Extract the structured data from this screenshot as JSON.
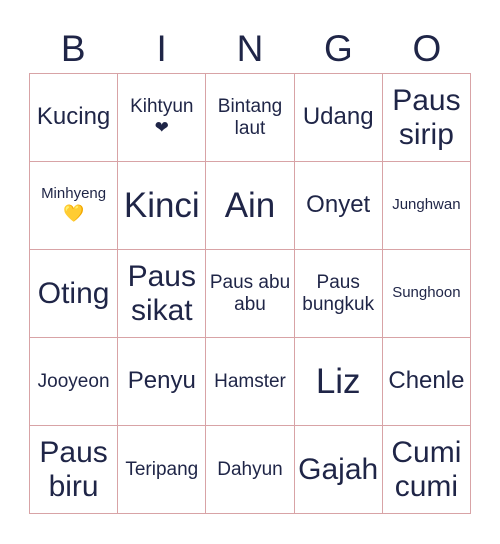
{
  "header": [
    "B",
    "I",
    "N",
    "G",
    "O"
  ],
  "colors": {
    "text": "#1f2547",
    "grid": "#d8a3a6",
    "yellow_heart": "#f6c21c"
  },
  "cells": [
    {
      "text": "Kucing",
      "size": "s-m"
    },
    {
      "text": "Kihtyun",
      "size": "s-s",
      "icon": "❤",
      "icon_name": "black-heart-icon",
      "icon_class": "heart-dark"
    },
    {
      "text": "Bintang laut",
      "size": "s-s"
    },
    {
      "text": "Udang",
      "size": "s-m"
    },
    {
      "text": "Paus sirip",
      "size": "s-l"
    },
    {
      "text": "Minhyeng",
      "size": "s-xs",
      "icon": "💛",
      "icon_name": "yellow-heart-icon",
      "icon_class": "heart-yellow"
    },
    {
      "text": "Kinci",
      "size": "s-xl"
    },
    {
      "text": "Ain",
      "size": "s-xl"
    },
    {
      "text": "Onyet",
      "size": "s-m"
    },
    {
      "text": "Junghwan",
      "size": "s-xs"
    },
    {
      "text": "Oting",
      "size": "s-l"
    },
    {
      "text": "Paus sikat",
      "size": "s-l"
    },
    {
      "text": "Paus abu abu",
      "size": "s-s"
    },
    {
      "text": "Paus bungkuk",
      "size": "s-s"
    },
    {
      "text": "Sunghoon",
      "size": "s-xs"
    },
    {
      "text": "Jooyeon",
      "size": "s-s"
    },
    {
      "text": "Penyu",
      "size": "s-m"
    },
    {
      "text": "Hamster",
      "size": "s-s"
    },
    {
      "text": "Liz",
      "size": "s-xl"
    },
    {
      "text": "Chenle",
      "size": "s-m"
    },
    {
      "text": "Paus biru",
      "size": "s-l"
    },
    {
      "text": "Teripang",
      "size": "s-s"
    },
    {
      "text": "Dahyun",
      "size": "s-s"
    },
    {
      "text": "Gajah",
      "size": "s-l"
    },
    {
      "text": "Cumi cumi",
      "size": "s-l"
    }
  ]
}
